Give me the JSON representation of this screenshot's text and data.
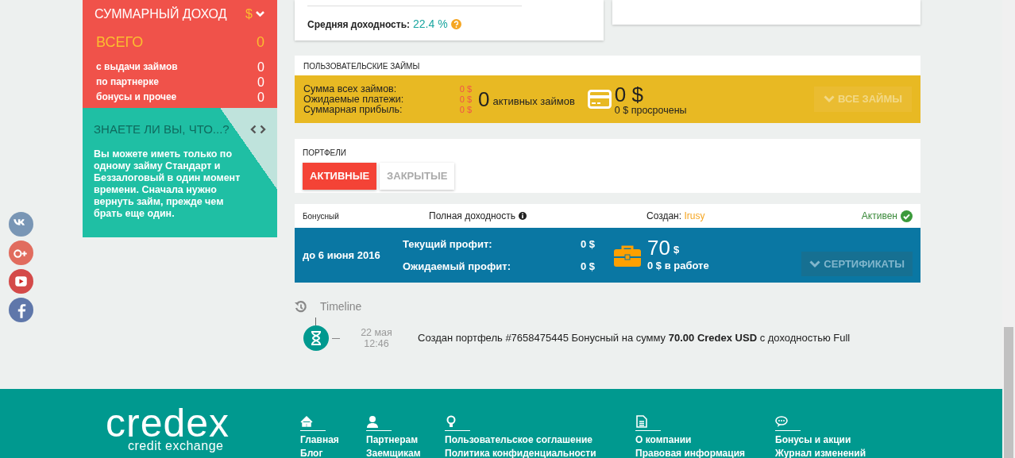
{
  "income": {
    "title": "СУММАРНЫЙ ДОХОД",
    "currency": "$",
    "total": {
      "label": "ВСЕГО",
      "value": "0"
    },
    "rows": [
      {
        "label": "с выдачи займов",
        "value": "0"
      },
      {
        "label": "по партнерке",
        "value": "0"
      },
      {
        "label": "бонусы и прочее",
        "value": "0"
      }
    ]
  },
  "tip": {
    "title": "ЗНАЕТЕ ЛИ ВЫ, ЧТО...?",
    "text": "Вы можете иметь только по одному займу Стандарт и Беззалоговый в один момент времени. Сначала нужно вернуть займ, прежде чем брать еще один."
  },
  "stats": {
    "label": "Средняя доходность:",
    "value": "22.4 %"
  },
  "loans": {
    "title": "ПОЛЬЗОВАТЕЛЬСКИЕ ЗАЙМЫ",
    "summary": [
      {
        "label": "Сумма всех займов:",
        "value": "0 $"
      },
      {
        "label": "Ожидаемые платежи:",
        "value": "0 $"
      },
      {
        "label": "Суммарная прибыль:",
        "value": "0 $"
      }
    ],
    "active_count": "0",
    "active_label": "активных займов",
    "overdue_amount": "0 $",
    "overdue_label": "0 $ просрочены",
    "button": "ВСЕ ЗАЙМЫ",
    "button_disabled": true
  },
  "portfolios": {
    "title": "ПОРТФЕЛИ",
    "tabs": [
      {
        "label": "АКТИВНЫЕ",
        "selected": true
      },
      {
        "label": "ЗАКРЫТЫЕ",
        "selected": false
      }
    ]
  },
  "portfolio": {
    "type": "Бонусный",
    "yield_label": "Полная доходность",
    "created_label": "Создан:",
    "creator": "Irusy",
    "status": "Активен",
    "due": "до 6 июня 2016",
    "profits": [
      {
        "label": "Текущий профит:",
        "value": "0 $"
      },
      {
        "label": "Ожидаемый профит:",
        "value": "0 $"
      }
    ],
    "amount": "70",
    "amount_unit": "$",
    "in_work": "0 $ в работе",
    "button": "СЕРТИФИКАТЫ",
    "button_disabled": true
  },
  "timeline": {
    "title": "Timeline",
    "events": [
      {
        "date": "22 мая",
        "time": "12:46",
        "text": "Создан портфель #7658475445 Бонусный на сумму **70.00 Credex USD** с доходностью Full"
      }
    ]
  },
  "footer": {
    "logo": "credex",
    "tagline": "credit exchange",
    "columns": [
      {
        "kind": "home",
        "links": [
          "Главная",
          "Блог"
        ]
      },
      {
        "kind": "person",
        "links": [
          "Партнерам",
          "Заемщикам"
        ]
      },
      {
        "kind": "bulb",
        "links": [
          "Пользовательское соглашение",
          "Политика конфиденциальности"
        ]
      },
      {
        "kind": "document",
        "links": [
          "О компании",
          "Правовая информация"
        ]
      },
      {
        "kind": "chat",
        "links": [
          "Бонусы и акции",
          "Журнал изменений"
        ]
      }
    ]
  }
}
